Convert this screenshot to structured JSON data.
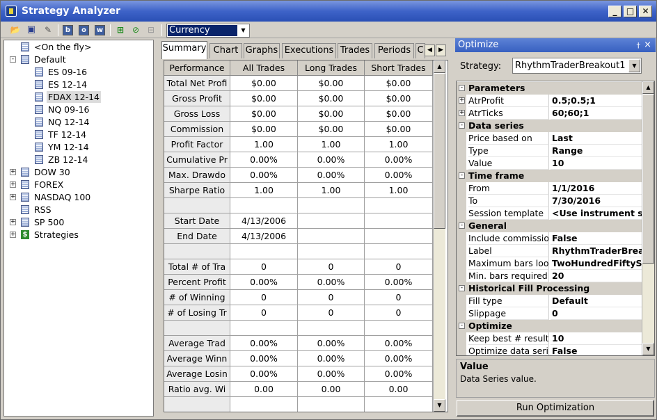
{
  "window": {
    "title": "Strategy Analyzer"
  },
  "toolbar": {
    "currency_value": "Currency",
    "buttons": [
      "open-icon",
      "save-icon",
      "report-icon",
      "b",
      "o",
      "w",
      "add-icon",
      "edit-icon",
      "remove-icon"
    ]
  },
  "tree": [
    {
      "label": "<On the fly>",
      "icon": "database-icon",
      "expander": ""
    },
    {
      "label": "Default",
      "icon": "database-icon",
      "expander": "-"
    },
    {
      "label": "ES 09-16",
      "icon": "database-icon",
      "expander": ""
    },
    {
      "label": "ES 12-14",
      "icon": "database-icon",
      "expander": ""
    },
    {
      "label": "FDAX 12-14",
      "icon": "database-icon",
      "expander": ""
    },
    {
      "label": "NQ 09-16",
      "icon": "database-icon",
      "expander": ""
    },
    {
      "label": "NQ 12-14",
      "icon": "database-icon",
      "expander": ""
    },
    {
      "label": "TF 12-14",
      "icon": "database-icon",
      "expander": ""
    },
    {
      "label": "YM 12-14",
      "icon": "database-icon",
      "expander": ""
    },
    {
      "label": "ZB 12-14",
      "icon": "database-icon",
      "expander": ""
    },
    {
      "label": "DOW 30",
      "icon": "database-icon",
      "expander": "+"
    },
    {
      "label": "FOREX",
      "icon": "database-icon",
      "expander": "+"
    },
    {
      "label": "NASDAQ 100",
      "icon": "database-icon",
      "expander": "+"
    },
    {
      "label": "RSS",
      "icon": "database-icon",
      "expander": ""
    },
    {
      "label": "SP 500",
      "icon": "database-icon",
      "expander": "+"
    },
    {
      "label": "Strategies",
      "icon": "dollar-icon",
      "expander": "+"
    }
  ],
  "tabs": [
    "Summary",
    "Chart",
    "Graphs",
    "Executions",
    "Trades",
    "Periods",
    "C"
  ],
  "grid": {
    "headers": [
      "Performance",
      "All Trades",
      "Long Trades",
      "Short Trades"
    ],
    "rows": [
      [
        "Total Net Profi",
        "$0.00",
        "$0.00",
        "$0.00"
      ],
      [
        "Gross Profit",
        "$0.00",
        "$0.00",
        "$0.00"
      ],
      [
        "Gross Loss",
        "$0.00",
        "$0.00",
        "$0.00"
      ],
      [
        "Commission",
        "$0.00",
        "$0.00",
        "$0.00"
      ],
      [
        "Profit Factor",
        "1.00",
        "1.00",
        "1.00"
      ],
      [
        "Cumulative Pr",
        "0.00%",
        "0.00%",
        "0.00%"
      ],
      [
        "Max. Drawdo",
        "0.00%",
        "0.00%",
        "0.00%"
      ],
      [
        "Sharpe Ratio",
        "1.00",
        "1.00",
        "1.00"
      ],
      [
        "",
        "",
        "",
        ""
      ],
      [
        "Start Date",
        "4/13/2006",
        "",
        ""
      ],
      [
        "End Date",
        "4/13/2006",
        "",
        ""
      ],
      [
        "",
        "",
        "",
        ""
      ],
      [
        "Total # of Tra",
        "0",
        "0",
        "0"
      ],
      [
        "Percent Profit",
        "0.00%",
        "0.00%",
        "0.00%"
      ],
      [
        "# of Winning",
        "0",
        "0",
        "0"
      ],
      [
        "# of Losing Tr",
        "0",
        "0",
        "0"
      ],
      [
        "",
        "",
        "",
        ""
      ],
      [
        "Average Trad",
        "0.00%",
        "0.00%",
        "0.00%"
      ],
      [
        "Average Winn",
        "0.00%",
        "0.00%",
        "0.00%"
      ],
      [
        "Average Losin",
        "0.00%",
        "0.00%",
        "0.00%"
      ],
      [
        "Ratio avg. Wi",
        "0.00",
        "0.00",
        "0.00"
      ],
      [
        "",
        "",
        "",
        ""
      ]
    ]
  },
  "optimize": {
    "title": "Optimize",
    "pin": "†",
    "close": "×",
    "strategy_label": "Strategy:",
    "strategy_value": "RhythmTraderBreakout1",
    "properties": [
      {
        "type": "cat",
        "name": "Parameters",
        "exp": "-"
      },
      {
        "type": "prop",
        "name": "AtrProfit",
        "value": "0.5;0.5;1",
        "exp": "+"
      },
      {
        "type": "prop",
        "name": "AtrTicks",
        "value": "60;60;1",
        "exp": "+"
      },
      {
        "type": "cat",
        "name": "Data series",
        "exp": "-"
      },
      {
        "type": "prop",
        "name": "Price based on",
        "value": "Last",
        "exp": ""
      },
      {
        "type": "prop",
        "name": "Type",
        "value": "Range",
        "exp": ""
      },
      {
        "type": "prop",
        "name": "Value",
        "value": "10",
        "exp": ""
      },
      {
        "type": "cat",
        "name": "Time frame",
        "exp": "-"
      },
      {
        "type": "prop",
        "name": "From",
        "value": "1/1/2016",
        "exp": ""
      },
      {
        "type": "prop",
        "name": "To",
        "value": "7/30/2016",
        "exp": ""
      },
      {
        "type": "prop",
        "name": "Session template",
        "value": "<Use instrument se",
        "exp": ""
      },
      {
        "type": "cat",
        "name": "General",
        "exp": "-"
      },
      {
        "type": "prop",
        "name": "Include commission",
        "value": "False",
        "exp": ""
      },
      {
        "type": "prop",
        "name": "Label",
        "value": "RhythmTraderBrea",
        "exp": ""
      },
      {
        "type": "prop",
        "name": "Maximum bars look",
        "value": "TwoHundredFiftyS",
        "exp": ""
      },
      {
        "type": "prop",
        "name": "Min. bars required",
        "value": "20",
        "exp": ""
      },
      {
        "type": "cat",
        "name": "Historical Fill Processing",
        "exp": "-"
      },
      {
        "type": "prop",
        "name": "Fill type",
        "value": "Default",
        "exp": ""
      },
      {
        "type": "prop",
        "name": "Slippage",
        "value": "0",
        "exp": ""
      },
      {
        "type": "cat",
        "name": "Optimize",
        "exp": "-"
      },
      {
        "type": "prop",
        "name": "Keep best # results",
        "value": "10",
        "exp": ""
      },
      {
        "type": "prop",
        "name": "Optimize data series",
        "value": "False",
        "exp": ""
      }
    ],
    "desc_title": "Value",
    "desc_text": "Data Series value.",
    "run_button": "Run Optimization"
  }
}
